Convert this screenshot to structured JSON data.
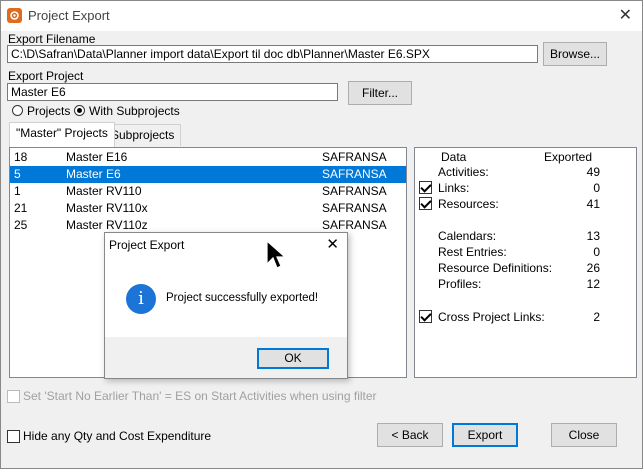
{
  "window": {
    "title": "Project Export",
    "close": "✕"
  },
  "export_filename": {
    "label": "Export Filename",
    "value": "C:\\D\\Safran\\Data\\Planner import data\\Export til doc db\\Planner\\Master E6.SPX",
    "browse": "Browse..."
  },
  "export_project": {
    "label": "Export Project",
    "value": "Master E6",
    "filter": "Filter..."
  },
  "scope": {
    "projects": "Projects",
    "with_subprojects": "With Subprojects",
    "selected": "with_subprojects"
  },
  "tabs": [
    {
      "label": "\"Master\" Projects",
      "active": true
    },
    {
      "label": "Subprojects",
      "active": false
    }
  ],
  "projects": [
    {
      "id": "18",
      "name": "Master E16",
      "owner": "SAFRANSA",
      "selected": false
    },
    {
      "id": "5",
      "name": "Master E6",
      "owner": "SAFRANSA",
      "selected": true
    },
    {
      "id": "1",
      "name": "Master RV110",
      "owner": "SAFRANSA",
      "selected": false
    },
    {
      "id": "21",
      "name": "Master RV110x",
      "owner": "SAFRANSA",
      "selected": false
    },
    {
      "id": "25",
      "name": "Master RV110z",
      "owner": "SAFRANSA",
      "selected": false
    }
  ],
  "data_panel": {
    "header_data": "Data",
    "header_exported": "Exported",
    "activities": {
      "label": "Activities:",
      "value": "49"
    },
    "links": {
      "label": "Links:",
      "value": "0",
      "checked": true
    },
    "resources": {
      "label": "Resources:",
      "value": "41",
      "checked": true
    },
    "calendars": {
      "label": "Calendars:",
      "value": "13"
    },
    "rest_entries": {
      "label": "Rest Entries:",
      "value": "0"
    },
    "resource_definitions": {
      "label": "Resource Definitions:",
      "value": "26"
    },
    "profiles": {
      "label": "Profiles:",
      "value": "12"
    },
    "cross_project_links": {
      "label": "Cross Project Links:",
      "value": "2",
      "checked": true
    }
  },
  "options": {
    "start_no_earlier": "Set 'Start No Earlier Than' = ES on Start Activities when using filter",
    "hide_qty": "Hide any Qty and Cost Expenditure"
  },
  "buttons": {
    "back": "< Back",
    "export": "Export",
    "close": "Close"
  },
  "dialog": {
    "title": "Project Export",
    "close": "✕",
    "message": "Project successfully exported!",
    "icon": "i",
    "ok": "OK"
  },
  "colors": {
    "selection": "#0078d7",
    "info_icon": "#1b74d6",
    "app_icon": "#e06a1e"
  }
}
